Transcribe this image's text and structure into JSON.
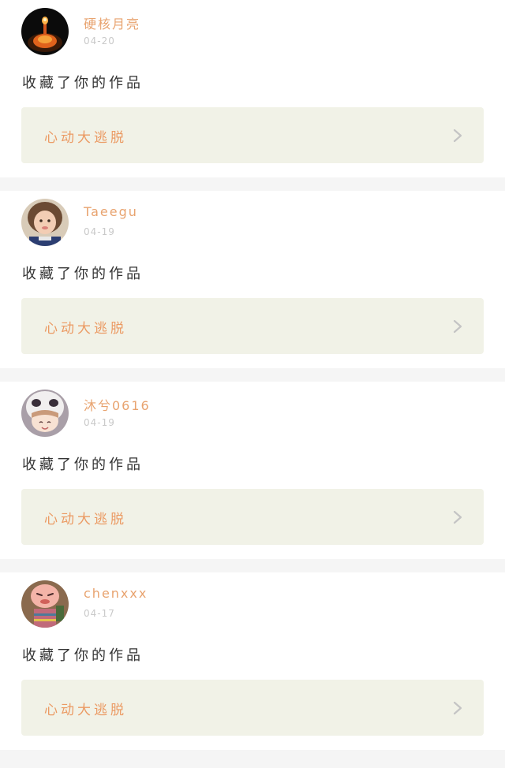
{
  "notifications": [
    {
      "username": "硬核月亮",
      "date": "04-20",
      "action": "收藏了你的作品",
      "work_title": "心动大逃脱",
      "avatar_icon": "avatar-lantern-icon"
    },
    {
      "username": "Taeegu",
      "date": "04-19",
      "action": "收藏了你的作品",
      "work_title": "心动大逃脱",
      "avatar_icon": "avatar-child-photo-icon"
    },
    {
      "username": "沐兮0616",
      "date": "04-19",
      "action": "收藏了你的作品",
      "work_title": "心动大逃脱",
      "avatar_icon": "avatar-panda-hood-icon"
    },
    {
      "username": "chenxxx",
      "date": "04-17",
      "action": "收藏了你的作品",
      "work_title": "心动大逃脱",
      "avatar_icon": "avatar-cartoon-icon"
    }
  ],
  "colors": {
    "username": "#e8a36f",
    "date": "#c9c9c9",
    "work_title": "#eb9a63",
    "work_bg": "#f1f2e7",
    "separator": "#f5f5f5"
  },
  "icons": {
    "chevron": "chevron-right-icon"
  }
}
